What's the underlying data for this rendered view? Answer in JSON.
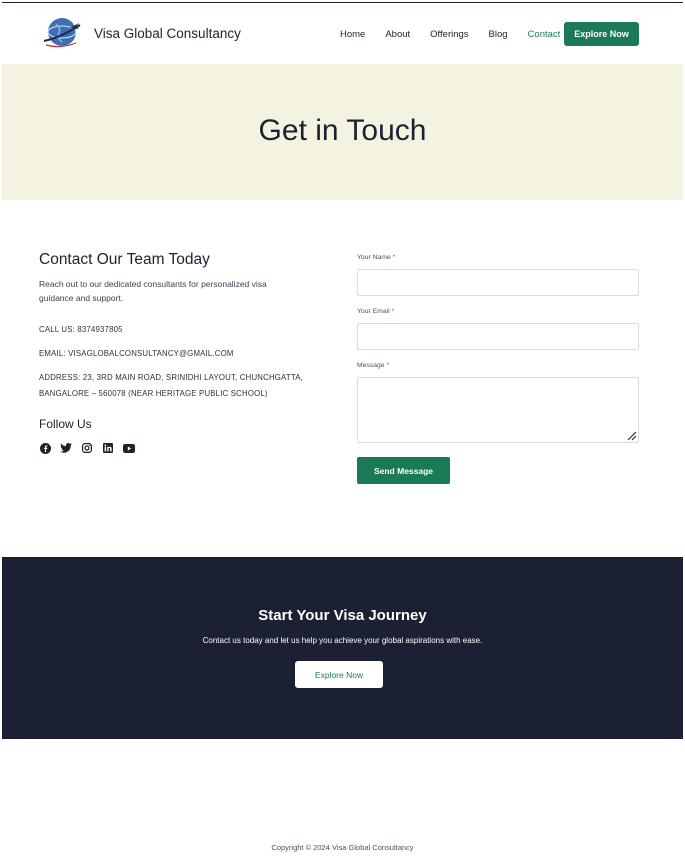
{
  "header": {
    "brand": "Visa Global Consultancy",
    "logo_icon": "globe-airplane-logo",
    "nav": [
      {
        "label": "Home",
        "active": false
      },
      {
        "label": "About",
        "active": false
      },
      {
        "label": "Offerings",
        "active": false
      },
      {
        "label": "Blog",
        "active": false
      },
      {
        "label": "Contact",
        "active": true
      }
    ],
    "cta_label": "Explore Now"
  },
  "hero": {
    "title": "Get in Touch"
  },
  "contact": {
    "title": "Contact Our Team Today",
    "description": "Reach out to our dedicated consultants for personalized visa guidance and support.",
    "call": "CALL US: 8374937805",
    "email": "EMAIL: VISAGLOBALCONSULTANCY@GMAIL.COM",
    "address": "ADDRESS: 23, 3RD MAIN ROAD, SRINIDHI LAYOUT, CHUNCHGATTA, BANGALORE – 560078 (NEAR HERITAGE PUBLIC SCHOOL)",
    "follow_title": "Follow Us",
    "socials": [
      "facebook-icon",
      "twitter-icon",
      "instagram-icon",
      "linkedin-icon",
      "youtube-icon"
    ]
  },
  "form": {
    "name_label": "Your Name",
    "email_label": "Your Email",
    "message_label": "Message",
    "required_mark": "*",
    "name_value": "",
    "email_value": "",
    "message_value": "",
    "submit_label": "Send Message"
  },
  "cta": {
    "title": "Start Your Visa Journey",
    "text": "Contact us today and let us help you achieve your global aspirations with ease.",
    "button_label": "Explore Now"
  },
  "footer": {
    "copyright": "Copyright © 2024 Visa Global Consultancy"
  },
  "colors": {
    "accent": "#1a7a55",
    "hero_bg": "#f4f3e1",
    "cta_bg": "#1b2133",
    "text": "#1c2230",
    "required": "#d23a3a"
  }
}
